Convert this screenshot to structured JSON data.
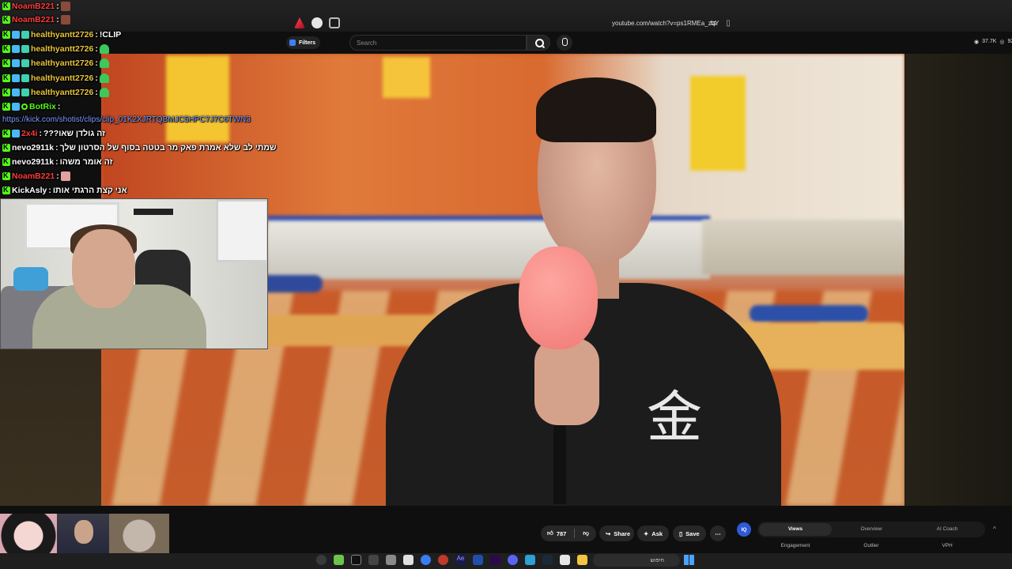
{
  "browser": {
    "url": "youtube.com/watch?v=ps1RMEa_zqY",
    "icons": [
      "brave-shield-icon",
      "extension-icon",
      "tab-icon",
      "translate-icon",
      "bookmark-icon"
    ]
  },
  "youtube": {
    "filters_label": "Filters",
    "search_placeholder": "Search",
    "stats": {
      "views": "37.7K",
      "count": "92"
    }
  },
  "chat": [
    {
      "badges": [
        "kick"
      ],
      "user": "NoamB221",
      "user_color": "#ff3b3b",
      "message": "",
      "emote": "brown"
    },
    {
      "badges": [
        "kick"
      ],
      "user": "NoamB221",
      "user_color": "#ff3b3b",
      "message": "",
      "emote": "brown"
    },
    {
      "badges": [
        "kick",
        "sub",
        "sub2"
      ],
      "user": "healthyantt2726",
      "user_color": "#e8c43a",
      "message": "!CLIP"
    },
    {
      "badges": [
        "kick",
        "sub",
        "sub2"
      ],
      "user": "healthyantt2726",
      "user_color": "#e8c43a",
      "message": "",
      "emote": "green"
    },
    {
      "badges": [
        "kick",
        "sub",
        "sub2"
      ],
      "user": "healthyantt2726",
      "user_color": "#e8c43a",
      "message": "",
      "emote": "green"
    },
    {
      "badges": [
        "kick",
        "sub",
        "sub2"
      ],
      "user": "healthyantt2726",
      "user_color": "#e8c43a",
      "message": "",
      "emote": "green"
    },
    {
      "badges": [
        "kick",
        "sub",
        "sub2"
      ],
      "user": "healthyantt2726",
      "user_color": "#e8c43a",
      "message": "",
      "emote": "green"
    },
    {
      "badges": [
        "kick",
        "sub",
        "bot"
      ],
      "user": "BotRix",
      "user_color": "#53fc18",
      "message": ""
    },
    {
      "link": "https://kick.com/shotist/clips/clip_01K2XJRTQBMJC5HPC7J7C6TWN3"
    },
    {
      "badges": [
        "kick",
        "sub"
      ],
      "user": "2x4i",
      "user_color": "#ff3b3b",
      "message": "???זה גולדן שאו"
    },
    {
      "badges": [
        "kick"
      ],
      "user": "nevo2911k",
      "user_color": "#ffffff",
      "message": "שמתי לב שלא אמרת פאק מר בטטה בסוף של הסרטון שלך"
    },
    {
      "badges": [
        "kick"
      ],
      "user": "nevo2911k",
      "user_color": "#ffffff",
      "message": "זה אומר משהו"
    },
    {
      "badges": [
        "kick"
      ],
      "user": "NoamB221",
      "user_color": "#ff3b3b",
      "message": "",
      "emote": "pink"
    },
    {
      "badges": [
        "kick"
      ],
      "user": "KickAsly",
      "user_color": "#ffffff",
      "message": "אני קצת הרגתי אותו"
    }
  ],
  "actions": {
    "likes": "787",
    "share": "Share",
    "ask": "Ask",
    "save": "Save",
    "more": "⋯"
  },
  "iq_panel": {
    "badge": "IQ",
    "tabs": [
      "Views",
      "Overview",
      "AI Coach"
    ],
    "active_tab": "Views",
    "columns": [
      "Engagement",
      "Outlier",
      "VPH"
    ]
  },
  "taskbar": {
    "search_label": "חיפוש"
  }
}
